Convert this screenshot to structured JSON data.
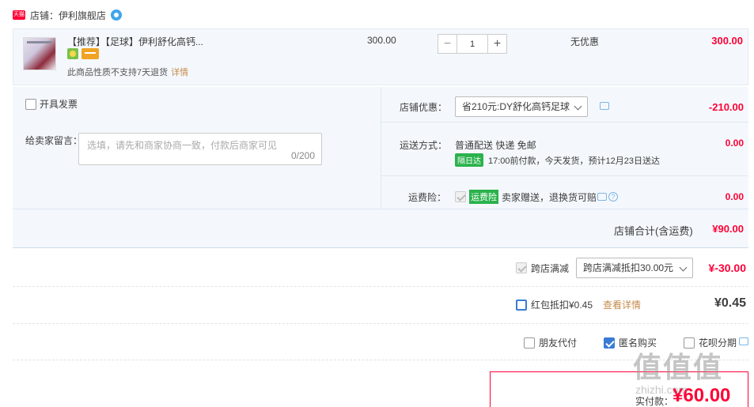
{
  "shop": {
    "badge": "天猫",
    "label": "店铺：伊利旗舰店"
  },
  "item": {
    "title": "【推荐】【足球】伊利舒化高钙...",
    "return_note": "此商品性质不支持7天退货",
    "detail_link": "详情",
    "unit_price": "300.00",
    "quantity": "1",
    "discount_text": "无优惠",
    "subtotal": "300.00"
  },
  "invoice_label": "开具发票",
  "message": {
    "label": "给卖家留言：",
    "placeholder": "选填，请先和商家协商一致，付款后商家可见",
    "count": "0/200"
  },
  "shop_discount": {
    "label": "店铺优惠：",
    "selected": "省210元:DY舒化高钙足球",
    "amount": "-210.00"
  },
  "shipping": {
    "label": "运送方式：",
    "method": "普通配送 快递 免邮",
    "nextday_badge": "隔日达",
    "nextday_text": "17:00前付款，今天发货，预计12月23日送达",
    "amount": "0.00"
  },
  "insurance": {
    "label": "运费险：",
    "badge": "运费险",
    "text": "卖家赠送，退换货可赔",
    "amount": "0.00"
  },
  "shop_total": {
    "label": "店铺合计(含运费)",
    "amount": "¥90.00"
  },
  "cross_store": {
    "label": "跨店满减",
    "selected": "跨店满减抵扣30.00元",
    "amount": "¥-30.00"
  },
  "hongbao": {
    "label": "红包抵扣¥0.45",
    "link": "查看详情",
    "amount": "¥0.45"
  },
  "options": {
    "friend_pay": "朋友代付",
    "anonymous": "匿名购买",
    "huabei": "花呗分期"
  },
  "payment": {
    "label": "实付款：",
    "amount": "¥60.00"
  },
  "watermark": {
    "main": "值值值",
    "sub": "zhizhi.com"
  },
  "colors": {
    "price_red": "#ff0036",
    "panel_bg": "#f4f8fc",
    "link_brown": "#c58b4a",
    "green_badge": "#2bb24c"
  }
}
